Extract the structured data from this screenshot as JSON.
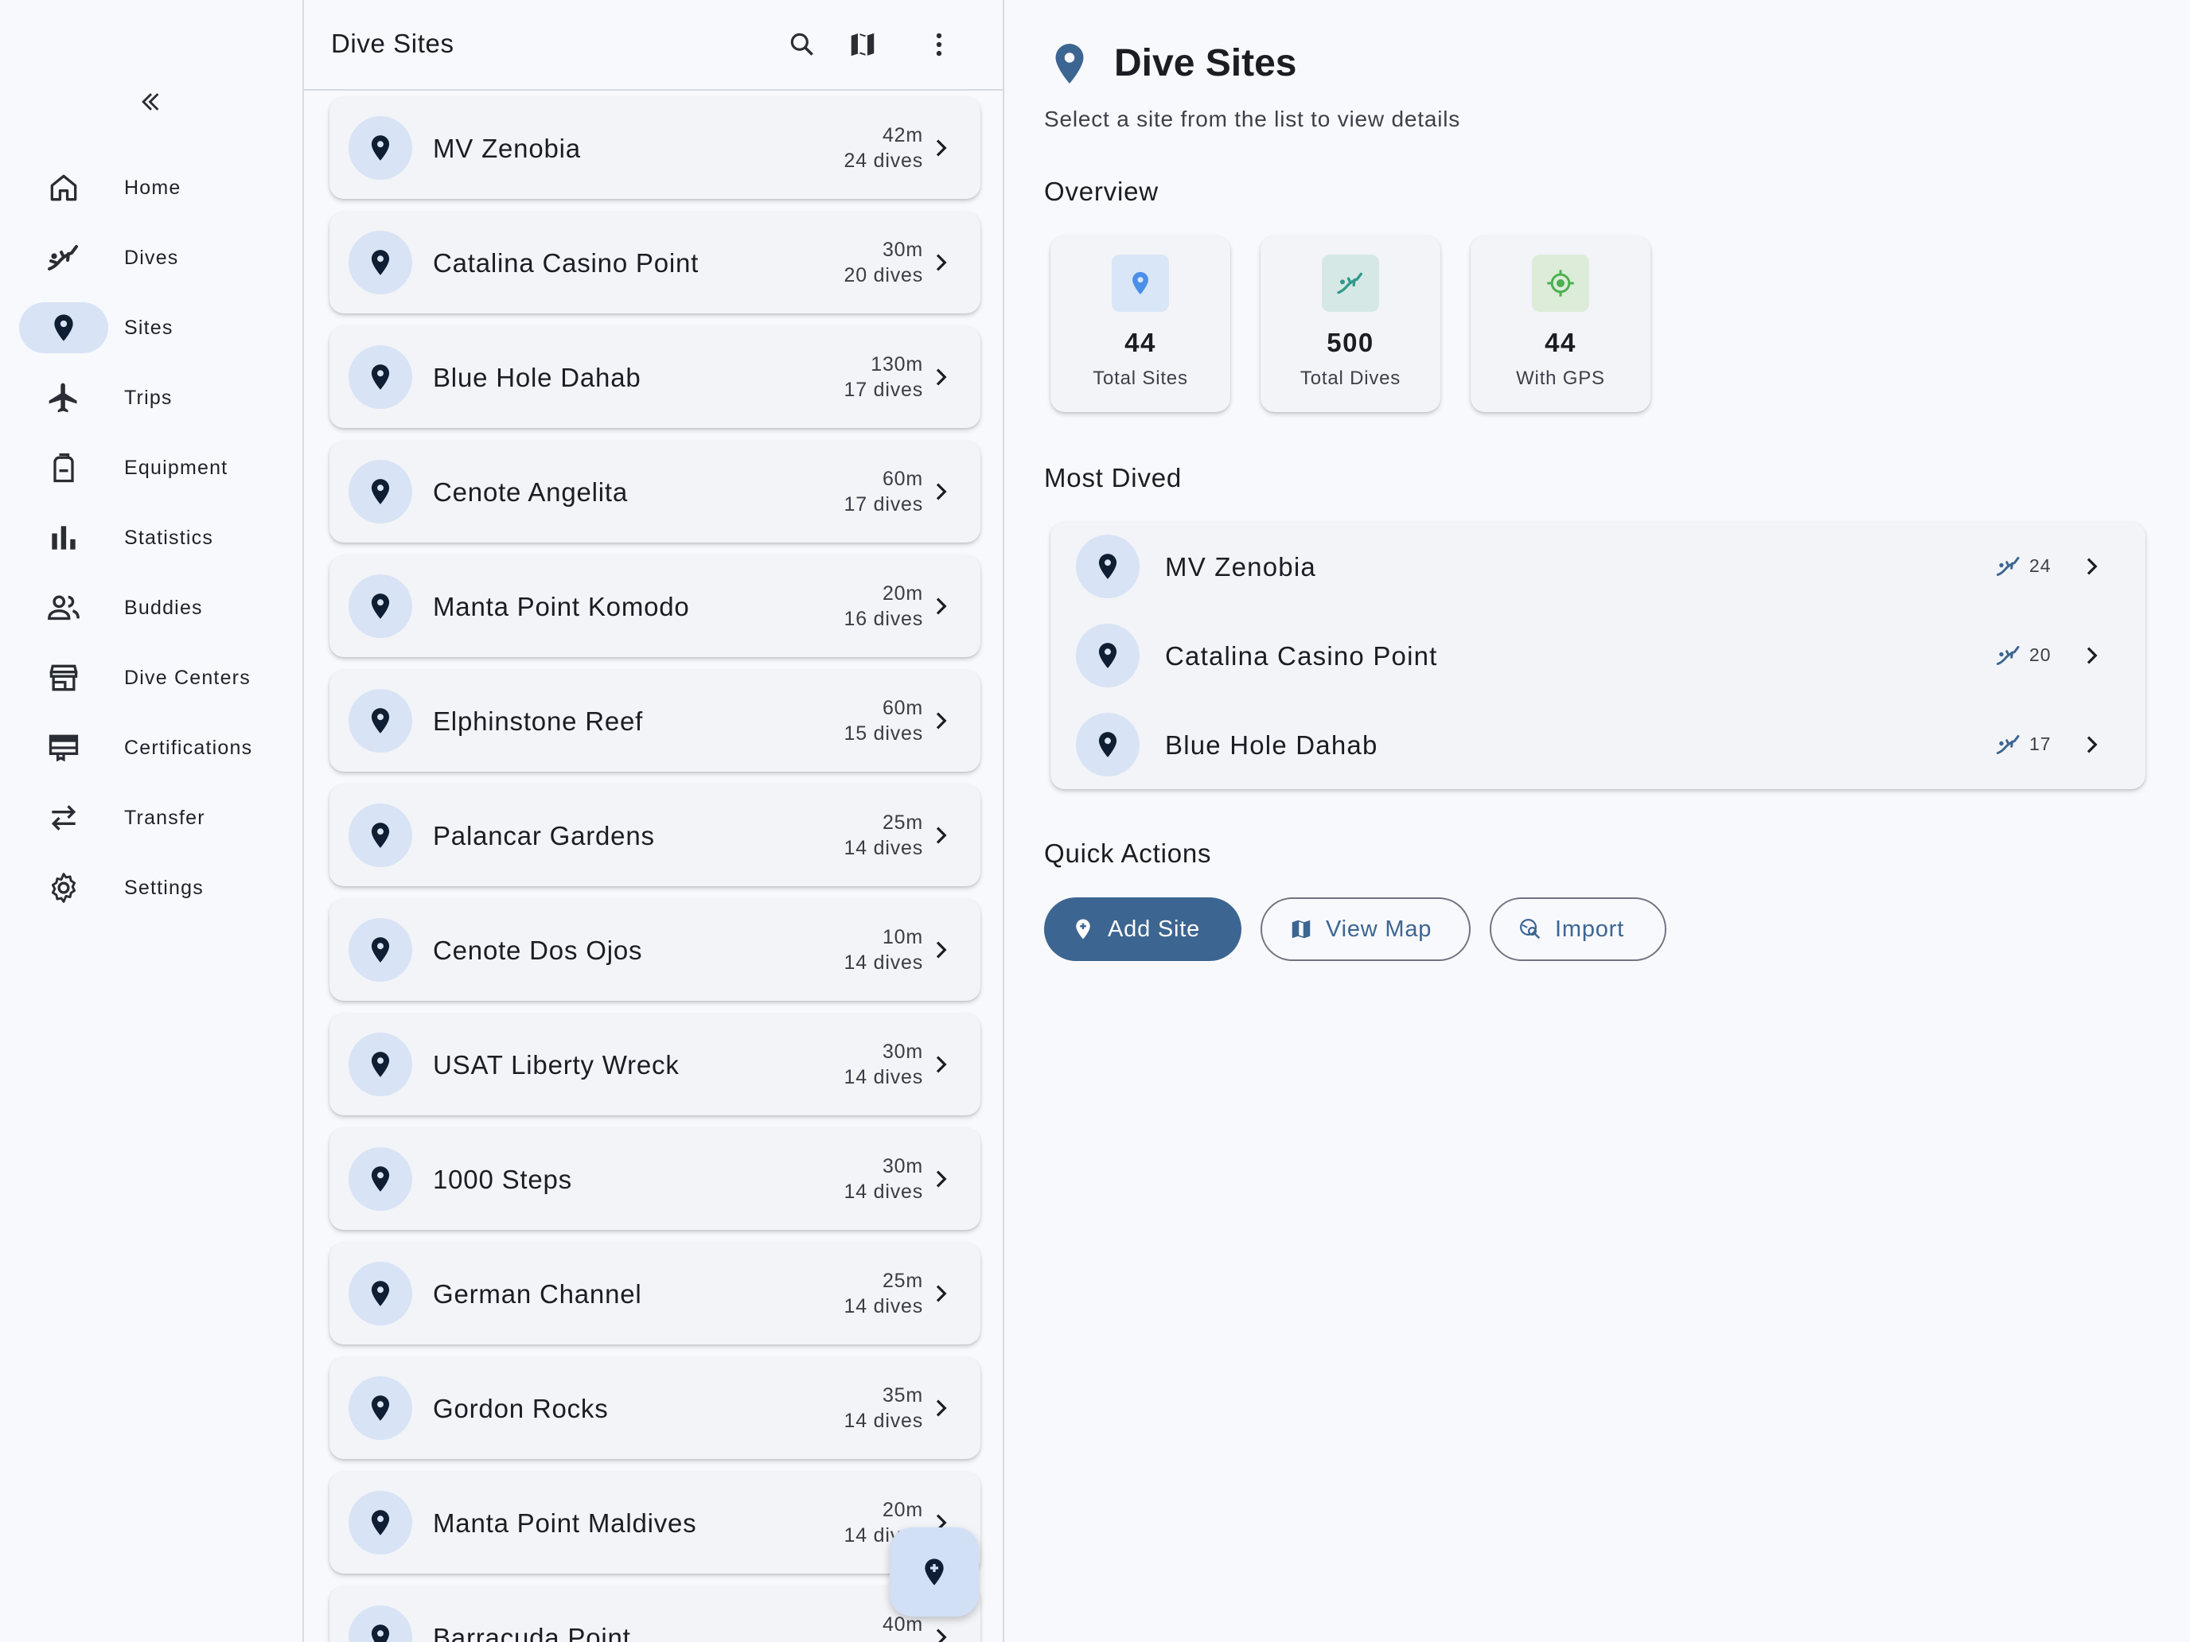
{
  "nav": {
    "items": [
      {
        "key": "home",
        "label": "Home",
        "icon": "home-icon"
      },
      {
        "key": "dives",
        "label": "Dives",
        "icon": "diver-icon"
      },
      {
        "key": "sites",
        "label": "Sites",
        "icon": "location-pin-icon",
        "active": true
      },
      {
        "key": "trips",
        "label": "Trips",
        "icon": "airplane-icon"
      },
      {
        "key": "equipment",
        "label": "Equipment",
        "icon": "backpack-icon"
      },
      {
        "key": "statistics",
        "label": "Statistics",
        "icon": "bar-chart-icon"
      },
      {
        "key": "buddies",
        "label": "Buddies",
        "icon": "people-icon"
      },
      {
        "key": "dive-centers",
        "label": "Dive Centers",
        "icon": "store-icon"
      },
      {
        "key": "certifications",
        "label": "Certifications",
        "icon": "card-membership-icon"
      },
      {
        "key": "transfer",
        "label": "Transfer",
        "icon": "swap-arrows-icon"
      },
      {
        "key": "settings",
        "label": "Settings",
        "icon": "gear-icon"
      }
    ]
  },
  "list": {
    "title": "Dive Sites",
    "sites": [
      {
        "name": "MV Zenobia",
        "depth": "42m",
        "dives": "24 dives"
      },
      {
        "name": "Catalina Casino Point",
        "depth": "30m",
        "dives": "20 dives"
      },
      {
        "name": "Blue Hole Dahab",
        "depth": "130m",
        "dives": "17 dives"
      },
      {
        "name": "Cenote Angelita",
        "depth": "60m",
        "dives": "17 dives"
      },
      {
        "name": "Manta Point Komodo",
        "depth": "20m",
        "dives": "16 dives"
      },
      {
        "name": "Elphinstone Reef",
        "depth": "60m",
        "dives": "15 dives"
      },
      {
        "name": "Palancar Gardens",
        "depth": "25m",
        "dives": "14 dives"
      },
      {
        "name": "Cenote Dos Ojos",
        "depth": "10m",
        "dives": "14 dives"
      },
      {
        "name": "USAT Liberty Wreck",
        "depth": "30m",
        "dives": "14 dives"
      },
      {
        "name": "1000 Steps",
        "depth": "30m",
        "dives": "14 dives"
      },
      {
        "name": "German Channel",
        "depth": "25m",
        "dives": "14 dives"
      },
      {
        "name": "Gordon Rocks",
        "depth": "35m",
        "dives": "14 dives"
      },
      {
        "name": "Manta Point Maldives",
        "depth": "20m",
        "dives": "14 dives"
      },
      {
        "name": "Barracuda Point",
        "depth": "40m",
        "dives": ""
      }
    ]
  },
  "detail": {
    "title": "Dive Sites",
    "subtitle": "Select a site from the list to view details",
    "overview_title": "Overview",
    "stats": [
      {
        "value": "44",
        "label": "Total Sites",
        "icon": "location-pin-icon",
        "color": "#4a8fe8",
        "bg": "#d9e6f7"
      },
      {
        "value": "500",
        "label": "Total Dives",
        "icon": "diver-icon",
        "color": "#2f9a8c",
        "bg": "#d6e8e5"
      },
      {
        "value": "44",
        "label": "With GPS",
        "icon": "gps-icon",
        "color": "#4caf50",
        "bg": "#dcecd8"
      }
    ],
    "most_dived_title": "Most Dived",
    "most_dived": [
      {
        "name": "MV Zenobia",
        "count": "24"
      },
      {
        "name": "Catalina Casino Point",
        "count": "20"
      },
      {
        "name": "Blue Hole Dahab",
        "count": "17"
      }
    ],
    "quick_actions_title": "Quick Actions",
    "actions": {
      "add_site": "Add Site",
      "view_map": "View Map",
      "import": "Import"
    }
  },
  "colors": {
    "primary": "#3d6591",
    "pin_bg": "#d8e3f5",
    "pin_fg": "#0f1e33"
  }
}
